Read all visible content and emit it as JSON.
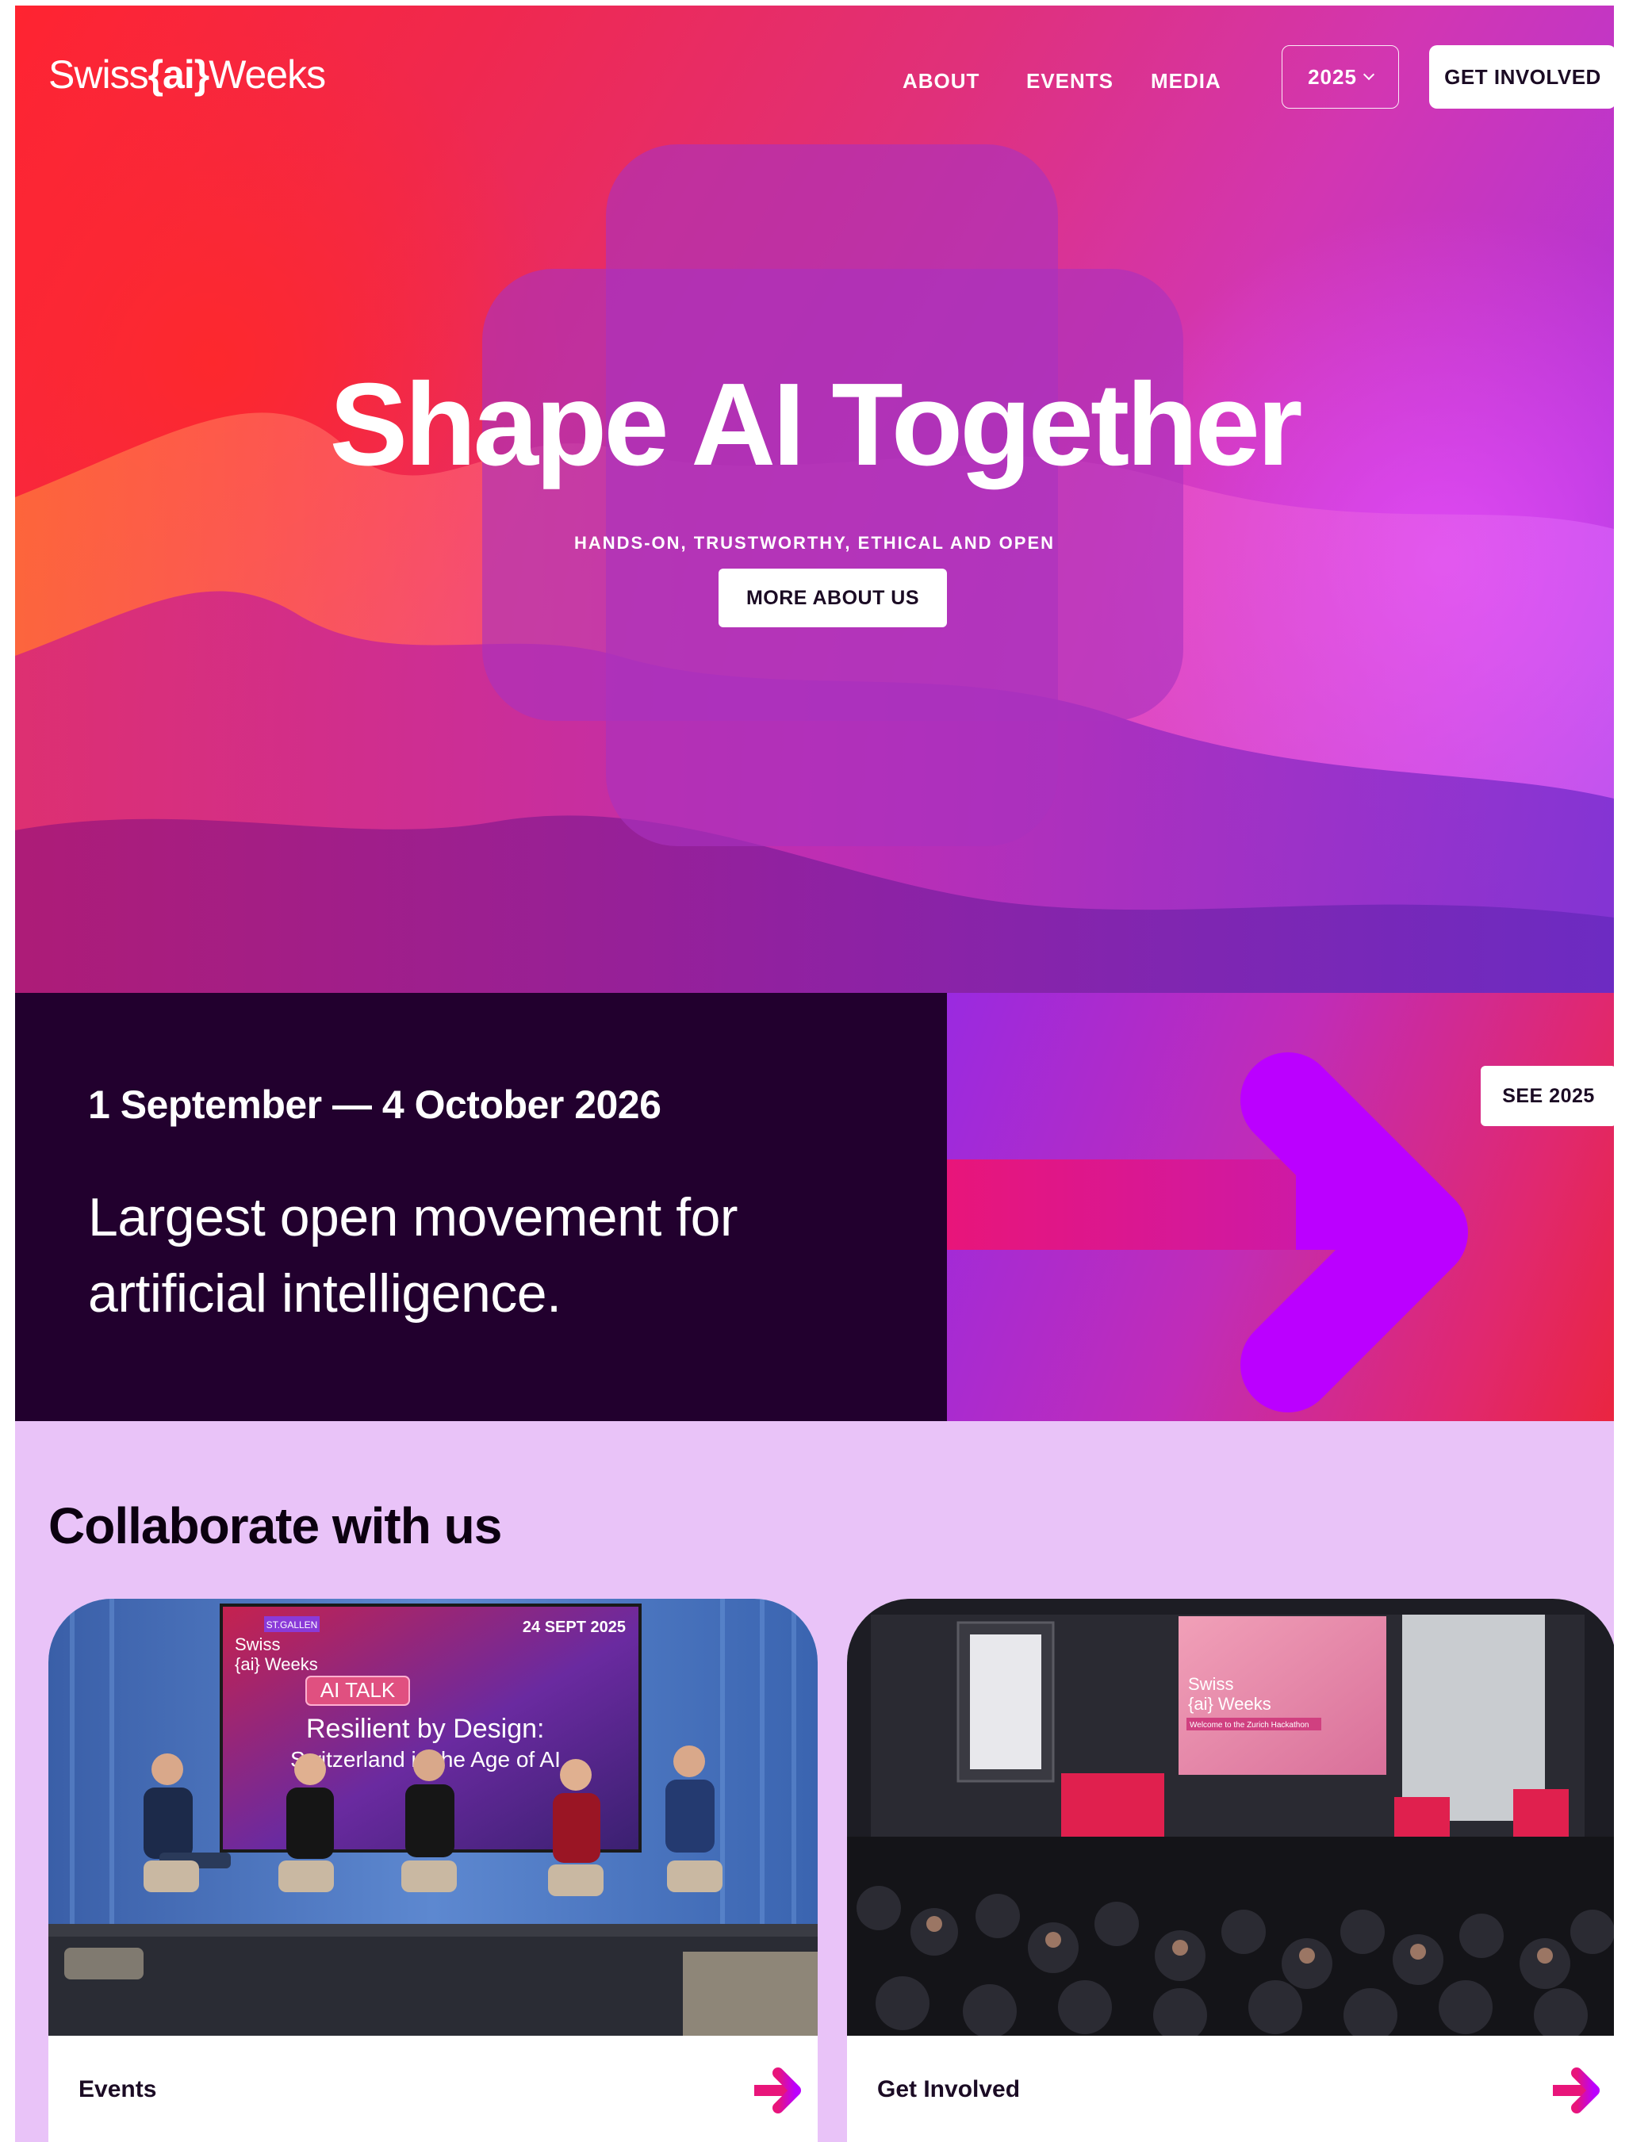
{
  "header": {
    "logo": {
      "prefix": "Swiss",
      "mid": "{ai}",
      "suffix": "Weeks"
    },
    "nav": [
      {
        "label": "ABOUT"
      },
      {
        "label": "EVENTS"
      },
      {
        "label": "MEDIA"
      }
    ],
    "year_selector": {
      "label": "2025"
    },
    "cta": {
      "label": "GET INVOLVED"
    }
  },
  "hero": {
    "title": "Shape AI Together",
    "subtitle": "HANDS-ON, TRUSTWORTHY, ETHICAL AND OPEN",
    "button": "MORE ABOUT US"
  },
  "band": {
    "date": "1 September — 4 October 2026",
    "text": "Largest open movement for artificial intelligence.",
    "see_button": "SEE 2025"
  },
  "collaborate": {
    "title": "Collaborate with us",
    "cards": [
      {
        "label": "Events",
        "photo": {
          "screen_tag": "ST.GALLEN",
          "screen_logo_1": "Swiss",
          "screen_logo_2": "{ai} Weeks",
          "screen_date": "24 SEPT 2025",
          "screen_badge": "AI TALK",
          "screen_title_1": "Resilient by Design:",
          "screen_title_2": "Switzerland in the Age of AI"
        }
      },
      {
        "label": "Get Involved",
        "photo": {
          "screen_logo_1": "Swiss",
          "screen_logo_2": "{ai} Weeks",
          "screen_welcome": "Welcome to the Zurich Hackathon"
        }
      }
    ]
  },
  "colors": {
    "dark_band": "#22002e",
    "lilac": "#e9c3f8",
    "accent_arrow": "#bb00ff",
    "accent_pink": "#e8157a"
  }
}
